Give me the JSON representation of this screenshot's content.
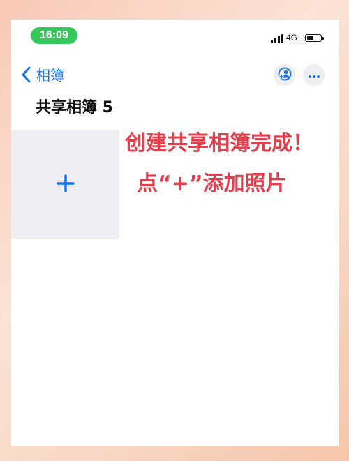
{
  "status_bar": {
    "time": "16:09",
    "network": "4G",
    "battery_level": 0.45,
    "accent_color": "#34c759"
  },
  "nav": {
    "back_label": "相簿",
    "back_icon": "chevron-left-icon",
    "people_icon": "shared-people-icon",
    "more_icon": "ellipsis-icon",
    "tint_color": "#1a73e8"
  },
  "album": {
    "title": "共享相簿 5",
    "add_icon": "plus-icon"
  },
  "annotation": {
    "line1": "创建共享相簿完成！",
    "line2": "点“+”添加照片",
    "color": "#e0414d"
  }
}
